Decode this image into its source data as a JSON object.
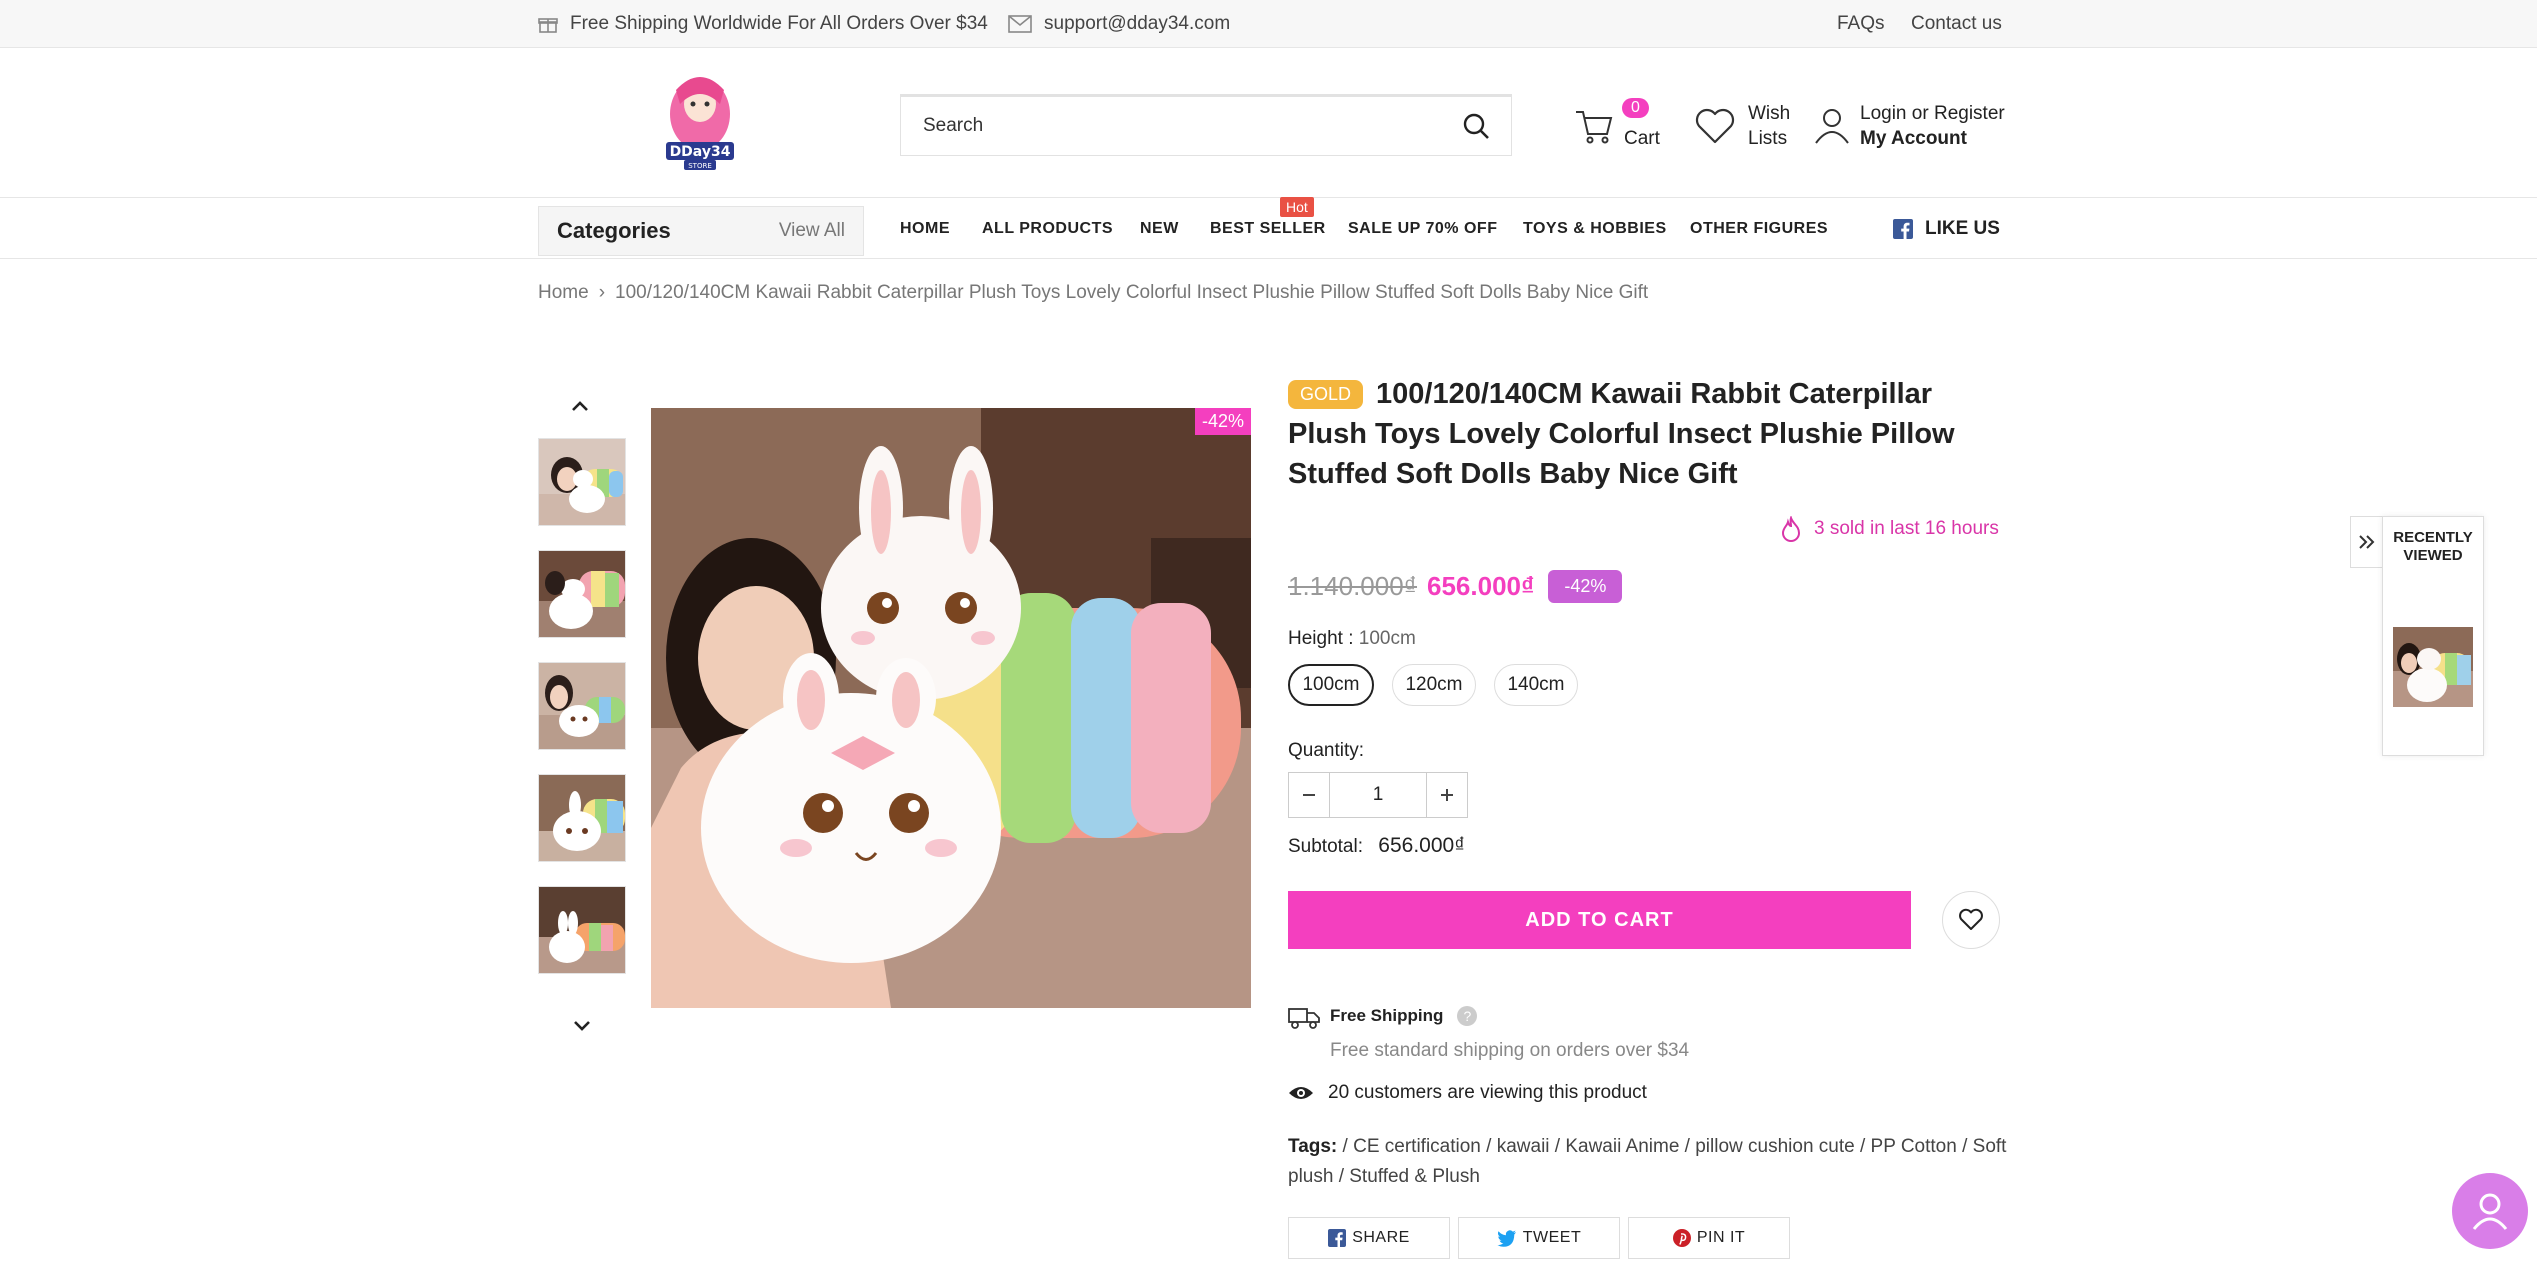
{
  "topbar": {
    "shipping": "Free Shipping Worldwide For All Orders Over $34",
    "email": "support@dday34.com",
    "faqs": "FAQs",
    "contact": "Contact us"
  },
  "header": {
    "logo_text": "DDay34",
    "logo_sub": "STORE",
    "search_placeholder": "Search",
    "cart_count": "0",
    "cart_label": "Cart",
    "wish_label_1": "Wish",
    "wish_label_2": "Lists",
    "login": "Login",
    "or": "or",
    "register": "Register",
    "account": "My Account"
  },
  "nav": {
    "categories": "Categories",
    "view_all": "View All",
    "links": [
      "HOME",
      "ALL PRODUCTS",
      "NEW",
      "BEST SELLER",
      "SALE UP 70% OFF",
      "TOYS & HOBBIES",
      "OTHER FIGURES"
    ],
    "hot": "Hot",
    "like_us": "LIKE US"
  },
  "breadcrumb": {
    "home": "Home",
    "current": "100/120/140CM Kawaii Rabbit Caterpillar Plush Toys Lovely Colorful Insect Plushie Pillow Stuffed Soft Dolls Baby Nice Gift"
  },
  "product": {
    "badge": "GOLD",
    "title": "100/120/140CM Kawaii Rabbit Caterpillar Plush Toys Lovely Colorful Insect Plushie Pillow Stuffed Soft Dolls Baby Nice Gift",
    "sold": "3 sold in last 16 hours",
    "old_price": "1.140.000₫",
    "price": "656.000₫",
    "discount": "-42%",
    "image_discount": "-42%",
    "height_label": "Height :",
    "height_value": "100cm",
    "sizes": [
      "100cm",
      "120cm",
      "140cm"
    ],
    "quantity_label": "Quantity:",
    "quantity": "1",
    "subtotal_label": "Subtotal:",
    "subtotal": "656.000₫",
    "add_to_cart": "ADD TO CART",
    "free_shipping": "Free Shipping",
    "free_shipping_desc": "Free standard shipping on orders over $34",
    "viewers": "20 customers are viewing this product",
    "tags_label": "Tags:",
    "tags": "/ CE certification / kawaii / Kawaii Anime / pillow cushion cute / PP Cotton / Soft plush / Stuffed & Plush",
    "share": "SHARE",
    "tweet": "TWEET",
    "pin": "PIN IT"
  },
  "recently_viewed": {
    "title_1": "RECENTLY",
    "title_2": "VIEWED"
  },
  "colors": {
    "accent": "#f43fbf",
    "gold": "#f4b63d",
    "discount_badge": "#c85fd6"
  }
}
